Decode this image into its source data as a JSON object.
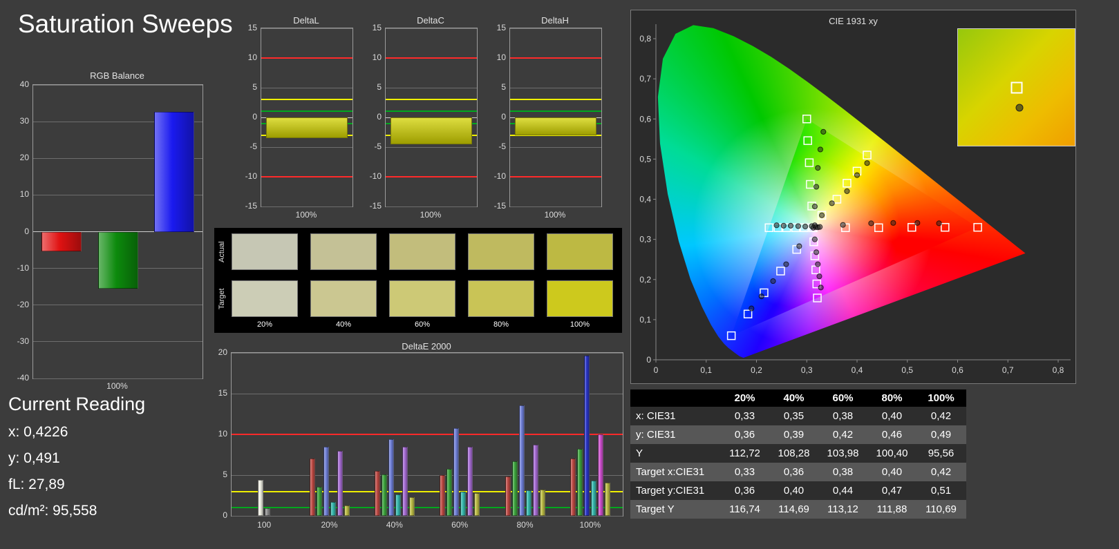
{
  "page": {
    "title": "Saturation Sweeps"
  },
  "current_reading": {
    "title": "Current Reading",
    "lines": [
      "x: 0,4226",
      "y: 0,491",
      "fL: 27,89",
      "cd/m²: 95,558"
    ]
  },
  "chart_data": [
    {
      "id": "rgb_balance",
      "type": "bar",
      "title": "RGB Balance",
      "categories": [
        "Red",
        "Green",
        "Blue"
      ],
      "values": [
        -5.4,
        -15.5,
        32.6
      ],
      "colors": [
        "#e01212",
        "#0c8a0c",
        "#1a1aef"
      ],
      "ylim": [
        -40,
        40
      ],
      "ytick_step": 10,
      "xlabel": "100%"
    },
    {
      "id": "delta_l",
      "type": "bar",
      "title": "DeltaL",
      "categories": [
        "100%"
      ],
      "values": [
        -3.5
      ],
      "colors": [
        "#d2d200"
      ],
      "ylim": [
        -15,
        15
      ],
      "ytick_step": 5,
      "xlabel": "100%",
      "ref_lines": [
        {
          "y": 10,
          "color": "#ff2a2a"
        },
        {
          "y": -10,
          "color": "#ff2a2a"
        },
        {
          "y": 3,
          "color": "#f0f000"
        },
        {
          "y": -3,
          "color": "#f0f000"
        },
        {
          "y": 1,
          "color": "#00a81e"
        },
        {
          "y": -1,
          "color": "#00a81e"
        }
      ]
    },
    {
      "id": "delta_c",
      "type": "bar",
      "title": "DeltaC",
      "categories": [
        "100%"
      ],
      "values": [
        -4.5
      ],
      "colors": [
        "#d2d200"
      ],
      "ylim": [
        -15,
        15
      ],
      "ytick_step": 5,
      "xlabel": "100%",
      "ref_lines": [
        {
          "y": 10,
          "color": "#ff2a2a"
        },
        {
          "y": -10,
          "color": "#ff2a2a"
        },
        {
          "y": 3,
          "color": "#f0f000"
        },
        {
          "y": -3,
          "color": "#f0f000"
        },
        {
          "y": 1,
          "color": "#00a81e"
        },
        {
          "y": -1,
          "color": "#00a81e"
        }
      ]
    },
    {
      "id": "delta_h",
      "type": "bar",
      "title": "DeltaH",
      "categories": [
        "100%"
      ],
      "values": [
        -3.0
      ],
      "colors": [
        "#d2d200"
      ],
      "ylim": [
        -15,
        15
      ],
      "ytick_step": 5,
      "xlabel": "100%",
      "ref_lines": [
        {
          "y": 10,
          "color": "#ff2a2a"
        },
        {
          "y": -10,
          "color": "#ff2a2a"
        },
        {
          "y": 3,
          "color": "#f0f000"
        },
        {
          "y": -3,
          "color": "#f0f000"
        },
        {
          "y": 1,
          "color": "#00a81e"
        },
        {
          "y": -1,
          "color": "#00a81e"
        }
      ]
    },
    {
      "id": "deltae2000",
      "type": "bar",
      "title": "DeltaE 2000",
      "ylim": [
        0,
        20
      ],
      "ytick_step": 5,
      "ref_lines": [
        {
          "y": 10,
          "color": "#ff2a2a"
        },
        {
          "y": 3,
          "color": "#f0f000"
        },
        {
          "y": 1,
          "color": "#00a81e"
        }
      ],
      "groups": [
        {
          "label": "100",
          "bars": [
            {
              "color": "#f0efe4",
              "value": 4.4
            },
            {
              "color": "#8f8f8f",
              "value": 0.9
            }
          ]
        },
        {
          "label": "20%",
          "bars": [
            {
              "color": "#bf4a44",
              "value": 7.0
            },
            {
              "color": "#3da53d",
              "value": 3.6
            },
            {
              "color": "#6f7fd8",
              "value": 8.5
            },
            {
              "color": "#35b8ad",
              "value": 1.7
            },
            {
              "color": "#a66bd4",
              "value": 8.0
            },
            {
              "color": "#bcbc45",
              "value": 1.3
            }
          ]
        },
        {
          "label": "40%",
          "bars": [
            {
              "color": "#bf4a44",
              "value": 5.5
            },
            {
              "color": "#3da53d",
              "value": 5.1
            },
            {
              "color": "#6f7fd8",
              "value": 9.4
            },
            {
              "color": "#35b8ad",
              "value": 2.6
            },
            {
              "color": "#a66bd4",
              "value": 8.5
            },
            {
              "color": "#bcbc45",
              "value": 2.3
            }
          ]
        },
        {
          "label": "60%",
          "bars": [
            {
              "color": "#bf4a44",
              "value": 5.0
            },
            {
              "color": "#3da53d",
              "value": 5.8
            },
            {
              "color": "#6f7fd8",
              "value": 10.8
            },
            {
              "color": "#35b8ad",
              "value": 3.0
            },
            {
              "color": "#a66bd4",
              "value": 8.5
            },
            {
              "color": "#bcbc45",
              "value": 2.8
            }
          ]
        },
        {
          "label": "80%",
          "bars": [
            {
              "color": "#bf4a44",
              "value": 4.8
            },
            {
              "color": "#3da53d",
              "value": 6.7
            },
            {
              "color": "#6f7fd8",
              "value": 13.6
            },
            {
              "color": "#35b8ad",
              "value": 3.1
            },
            {
              "color": "#a66bd4",
              "value": 8.7
            },
            {
              "color": "#bcbc45",
              "value": 3.2
            }
          ]
        },
        {
          "label": "100%",
          "bars": [
            {
              "color": "#bf4a44",
              "value": 7.0
            },
            {
              "color": "#3da53d",
              "value": 8.2
            },
            {
              "color": "#2a35c8",
              "value": 19.7
            },
            {
              "color": "#35b8ad",
              "value": 4.3
            },
            {
              "color": "#cf4fcf",
              "value": 10.0
            },
            {
              "color": "#bcbc45",
              "value": 4.1
            }
          ]
        }
      ]
    },
    {
      "id": "cie1931",
      "type": "scatter",
      "title": "CIE 1931 xy",
      "xlim": [
        0,
        0.8
      ],
      "ylim": [
        0,
        0.8
      ],
      "xticks": [
        "0",
        "0,1",
        "0,2",
        "0,3",
        "0,4",
        "0,5",
        "0,6",
        "0,7",
        "0,8"
      ],
      "yticks": [
        "0",
        "0,1",
        "0,2",
        "0,3",
        "0,4",
        "0,5",
        "0,6",
        "0,7",
        "0,8"
      ],
      "white_point": {
        "target": [
          0.3127,
          0.329
        ]
      },
      "white_cluster": [
        [
          0.313,
          0.329
        ],
        [
          0.318,
          0.331
        ],
        [
          0.322,
          0.33
        ],
        [
          0.316,
          0.335
        ],
        [
          0.31,
          0.333
        ],
        [
          0.326,
          0.331
        ]
      ],
      "sweeps": [
        {
          "name": "red",
          "targets": [
            [
              0.377,
              0.329
            ],
            [
              0.443,
              0.329
            ],
            [
              0.509,
              0.33
            ],
            [
              0.575,
              0.33
            ],
            [
              0.64,
              0.33
            ]
          ],
          "measured": [
            [
              0.372,
              0.336
            ],
            [
              0.428,
              0.34
            ],
            [
              0.472,
              0.341
            ],
            [
              0.52,
              0.341
            ],
            [
              0.563,
              0.34
            ]
          ]
        },
        {
          "name": "green",
          "targets": [
            [
              0.31,
              0.383
            ],
            [
              0.307,
              0.437
            ],
            [
              0.305,
              0.491
            ],
            [
              0.302,
              0.546
            ],
            [
              0.3,
              0.6
            ]
          ],
          "measured": [
            [
              0.316,
              0.382
            ],
            [
              0.319,
              0.431
            ],
            [
              0.322,
              0.478
            ],
            [
              0.327,
              0.524
            ],
            [
              0.333,
              0.568
            ]
          ]
        },
        {
          "name": "blue",
          "targets": [
            [
              0.28,
              0.275
            ],
            [
              0.248,
              0.221
            ],
            [
              0.215,
              0.167
            ],
            [
              0.183,
              0.114
            ],
            [
              0.15,
              0.06
            ]
          ],
          "measured": [
            [
              0.285,
              0.283
            ],
            [
              0.259,
              0.238
            ],
            [
              0.233,
              0.196
            ],
            [
              0.21,
              0.158
            ],
            [
              0.19,
              0.128
            ]
          ]
        },
        {
          "name": "cyan",
          "targets": [
            [
              0.295,
              0.329
            ],
            [
              0.278,
              0.329
            ],
            [
              0.26,
              0.329
            ],
            [
              0.243,
              0.329
            ],
            [
              0.225,
              0.329
            ]
          ],
          "measured": [
            [
              0.297,
              0.332
            ],
            [
              0.283,
              0.333
            ],
            [
              0.268,
              0.334
            ],
            [
              0.254,
              0.334
            ],
            [
              0.24,
              0.335
            ]
          ]
        },
        {
          "name": "magenta",
          "targets": [
            [
              0.314,
              0.294
            ],
            [
              0.316,
              0.259
            ],
            [
              0.318,
              0.224
            ],
            [
              0.32,
              0.189
            ],
            [
              0.321,
              0.154
            ]
          ],
          "measured": [
            [
              0.316,
              0.3
            ],
            [
              0.319,
              0.268
            ],
            [
              0.322,
              0.238
            ],
            [
              0.325,
              0.208
            ],
            [
              0.328,
              0.18
            ]
          ]
        },
        {
          "name": "yellow",
          "targets": [
            [
              0.33,
              0.36
            ],
            [
              0.36,
              0.4
            ],
            [
              0.38,
              0.44
            ],
            [
              0.4,
              0.47
            ],
            [
              0.42,
              0.51
            ]
          ],
          "measured": [
            [
              0.33,
              0.36
            ],
            [
              0.35,
              0.39
            ],
            [
              0.38,
              0.42
            ],
            [
              0.4,
              0.46
            ],
            [
              0.42,
              0.49
            ]
          ]
        }
      ],
      "inset": {
        "square": [
          0.42,
          0.51
        ],
        "dot": [
          0.4226,
          0.491
        ]
      }
    }
  ],
  "swatches": {
    "row_labels": [
      "Actual",
      "Target"
    ],
    "col_labels": [
      "20%",
      "40%",
      "60%",
      "80%",
      "100%"
    ],
    "actual": [
      "#c6c7b4",
      "#c4c196",
      "#c2bd7c",
      "#bfba5f",
      "#bdb943"
    ],
    "target": [
      "#cccdb6",
      "#cbc791",
      "#cdc976",
      "#c9c456",
      "#cdc91d"
    ]
  },
  "table": {
    "header": [
      "20%",
      "40%",
      "60%",
      "80%",
      "100%"
    ],
    "rows": [
      {
        "label": "x: CIE31",
        "values": [
          "0,33",
          "0,35",
          "0,38",
          "0,40",
          "0,42"
        ]
      },
      {
        "label": "y: CIE31",
        "values": [
          "0,36",
          "0,39",
          "0,42",
          "0,46",
          "0,49"
        ]
      },
      {
        "label": "Y",
        "values": [
          "112,72",
          "108,28",
          "103,98",
          "100,40",
          "95,56"
        ]
      },
      {
        "label": "Target x:CIE31",
        "values": [
          "0,33",
          "0,36",
          "0,38",
          "0,40",
          "0,42"
        ]
      },
      {
        "label": "Target y:CIE31",
        "values": [
          "0,36",
          "0,40",
          "0,44",
          "0,47",
          "0,51"
        ]
      },
      {
        "label": "Target Y",
        "values": [
          "116,74",
          "114,69",
          "113,12",
          "111,88",
          "110,69"
        ]
      }
    ]
  }
}
